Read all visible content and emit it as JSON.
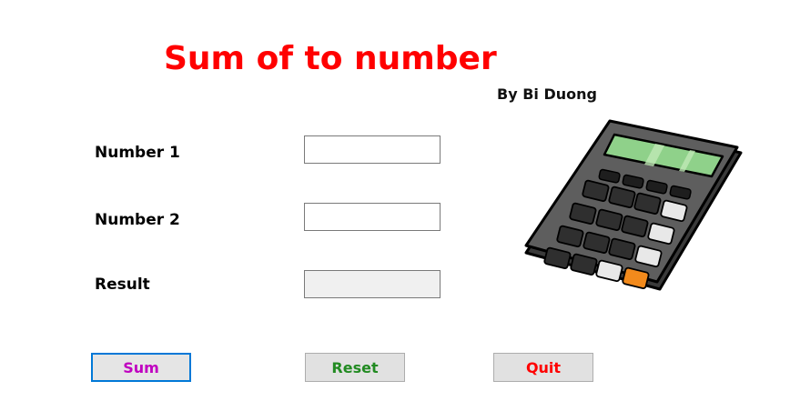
{
  "title": "Sum of to number",
  "author": "By Bi Duong",
  "form": {
    "number1_label": "Number 1",
    "number1_value": "",
    "number2_label": "Number 2",
    "number2_value": "",
    "result_label": "Result",
    "result_value": ""
  },
  "buttons": {
    "sum": {
      "label": "Sum",
      "color": "#c000c0"
    },
    "reset": {
      "label": "Reset",
      "color": "#228b22"
    },
    "quit": {
      "label": "Quit",
      "color": "#ff0000"
    }
  },
  "colors": {
    "title": "#ff0000",
    "focus_border": "#0078d7",
    "calculator_display": "#8fd18a",
    "calculator_accent_key": "#f28a1c"
  },
  "image": {
    "icon": "calculator-icon"
  }
}
